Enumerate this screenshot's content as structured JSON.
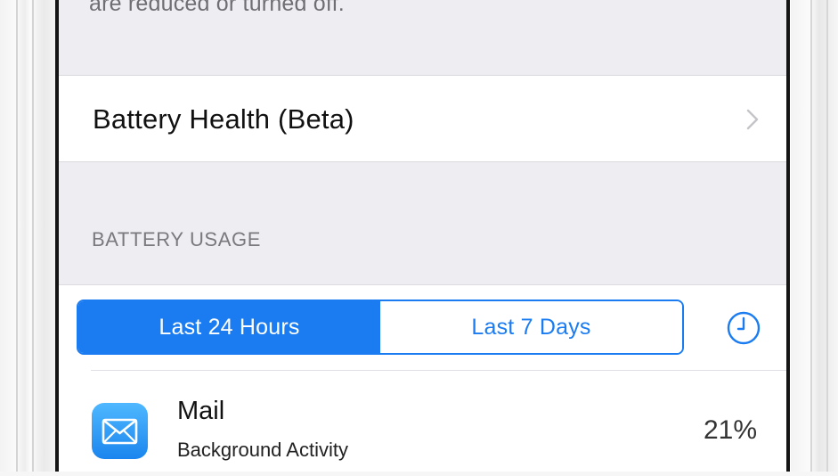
{
  "power_note": {
    "text": "are reduced or turned off."
  },
  "battery_health": {
    "label": "Battery Health (Beta)",
    "icon": "chevron-right-icon"
  },
  "battery_usage": {
    "header": "BATTERY USAGE",
    "segments": [
      {
        "label": "Last 24 Hours",
        "selected": true
      },
      {
        "label": "Last 7 Days",
        "selected": false
      }
    ],
    "clock_icon": "clock-icon",
    "apps": [
      {
        "name": "Mail",
        "subtitle": "Background Activity",
        "percent": "21%",
        "icon": "mail-envelope-icon"
      }
    ]
  },
  "colors": {
    "accent": "#1b7cf2",
    "grouped_background": "#eeedf2",
    "cell_background": "#ffffff",
    "secondary_text": "#79797e"
  }
}
